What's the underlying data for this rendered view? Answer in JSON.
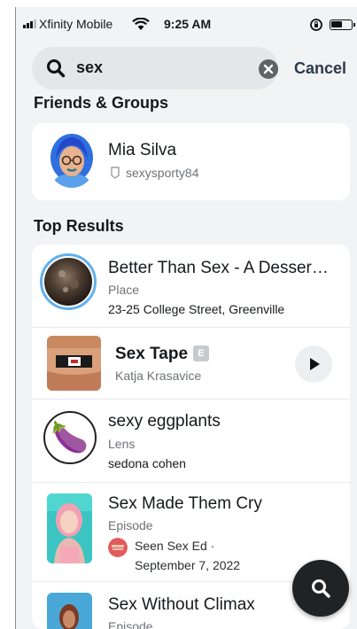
{
  "status_bar": {
    "carrier": "Xfinity Mobile",
    "time": "9:25 AM"
  },
  "search": {
    "value": "sex",
    "cancel_label": "Cancel"
  },
  "sections": {
    "friends_title": "Friends & Groups",
    "top_results_title": "Top Results"
  },
  "friends": [
    {
      "name": "Mia Silva",
      "username": "sexysporty84"
    }
  ],
  "results": [
    {
      "title": "Better Than Sex - A Desser…",
      "type": "Place",
      "detail": "23-25 College Street, Greenville"
    },
    {
      "title": "Sex Tape",
      "badge": "E",
      "subtitle": "Katja Krasavice"
    },
    {
      "title": "sexy eggplants",
      "type": "Lens",
      "detail": "sedona cohen",
      "emoji": "🍆"
    },
    {
      "title": "Sex Made Them Cry",
      "type": "Episode",
      "detail_line1": "Seen Sex Ed ·",
      "detail_line2": "September 7, 2022"
    },
    {
      "title": "Sex Without Climax",
      "type": "Episode"
    }
  ],
  "colors": {
    "background": "#f2f3f5",
    "card": "#ffffff",
    "search_field": "#e4e6e9",
    "fab": "#202326",
    "secondary_text": "#6e7276"
  },
  "icons": [
    "signal-icon",
    "wifi-icon",
    "orientation-lock-icon",
    "battery-icon",
    "search-icon",
    "clear-icon",
    "snapcode-icon",
    "play-icon"
  ]
}
